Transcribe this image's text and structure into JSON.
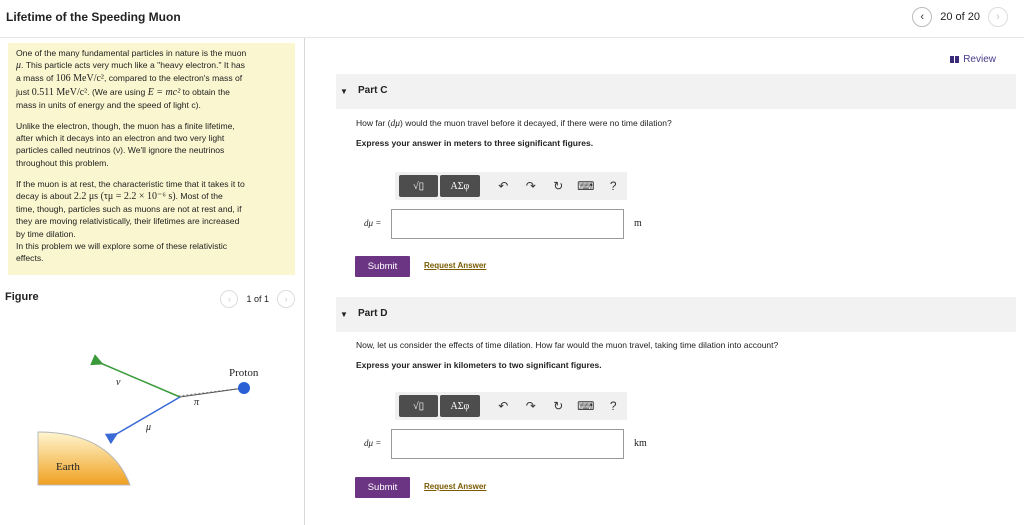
{
  "header": {
    "title": "Lifetime of the Speeding Muon",
    "page_indicator": "20 of 20",
    "prev_icon": "chevron-left-icon",
    "next_icon": "chevron-right-icon"
  },
  "intro": {
    "p1_a": "One of the many fundamental particles in nature is the muon",
    "p1_b_sym": "μ",
    "p1_b": ". This particle acts very much like a \"heavy electron.\" It has",
    "p1_c_pre": "a mass of ",
    "p1_c_math": "106 MeV/c²",
    "p1_c_post": ", compared to the electron's mass of",
    "p1_d_pre": "just ",
    "p1_d_math": "0.511 MeV/c²",
    "p1_d_mid": ". (We are using ",
    "p1_d_math2": "E = mc²",
    "p1_d_post": " to obtain the",
    "p1_e": "mass in units of energy and the speed of light c).",
    "p2_a": "Unlike the electron, though, the muon has a finite lifetime,",
    "p2_b": "after which it decays into an electron and two very light",
    "p2_c": "particles called neutrinos (ν). We'll ignore the neutrinos",
    "p2_d": "throughout this problem.",
    "p3_a": "If the muon is at rest, the characteristic time that it takes it to",
    "p3_b_pre": "decay is about ",
    "p3_b_math": "2.2 μs (τμ = 2.2 × 10⁻⁶ s)",
    "p3_b_post": ". Most of the",
    "p3_c": "time, though, particles such as muons are not at rest and, if",
    "p3_d": "they are moving relativistically, their lifetimes are increased",
    "p3_e": "by time dilation.",
    "p3_f": "In this problem we will explore some of these relativistic",
    "p3_g": "effects."
  },
  "figure": {
    "title": "Figure",
    "pager": "1 of 1",
    "label_proton": "Proton",
    "label_nu": "ν",
    "label_pi": "π",
    "label_mu": "μ",
    "label_earth": "Earth",
    "colors": {
      "proton": "#2a5fd6",
      "nu_track": "#3a9a3a",
      "mu_track": "#3a6ad6",
      "earth_top": "#fff6d0",
      "earth_bottom": "#f0a020"
    }
  },
  "review": {
    "label": "Review"
  },
  "parts": [
    {
      "label": "Part C",
      "question_pre": "How far (",
      "question_math": "dμ",
      "question_post": ") would the muon travel before it decayed, if there were no time dilation?",
      "instruction": "Express your answer in meters to three significant figures.",
      "answer_label": "dμ =",
      "answer_value": "",
      "unit": "m",
      "submit": "Submit",
      "request": "Request Answer"
    },
    {
      "label": "Part D",
      "question_pre": "Now, let us consider the effects of time dilation. How far would the muon travel, taking time dilation into account?",
      "question_math": "",
      "question_post": "",
      "instruction": "Express your answer in kilometers to two significant figures.",
      "answer_label": "dμ =",
      "answer_value": "",
      "unit": "km",
      "submit": "Submit",
      "request": "Request Answer"
    }
  ],
  "toolbar": {
    "templates": "√▯",
    "symbols": "ΑΣφ",
    "undo_icon": "undo-icon",
    "redo_icon": "redo-icon",
    "reset_icon": "reset-icon",
    "keyboard_icon": "keyboard-icon",
    "help": "?"
  }
}
